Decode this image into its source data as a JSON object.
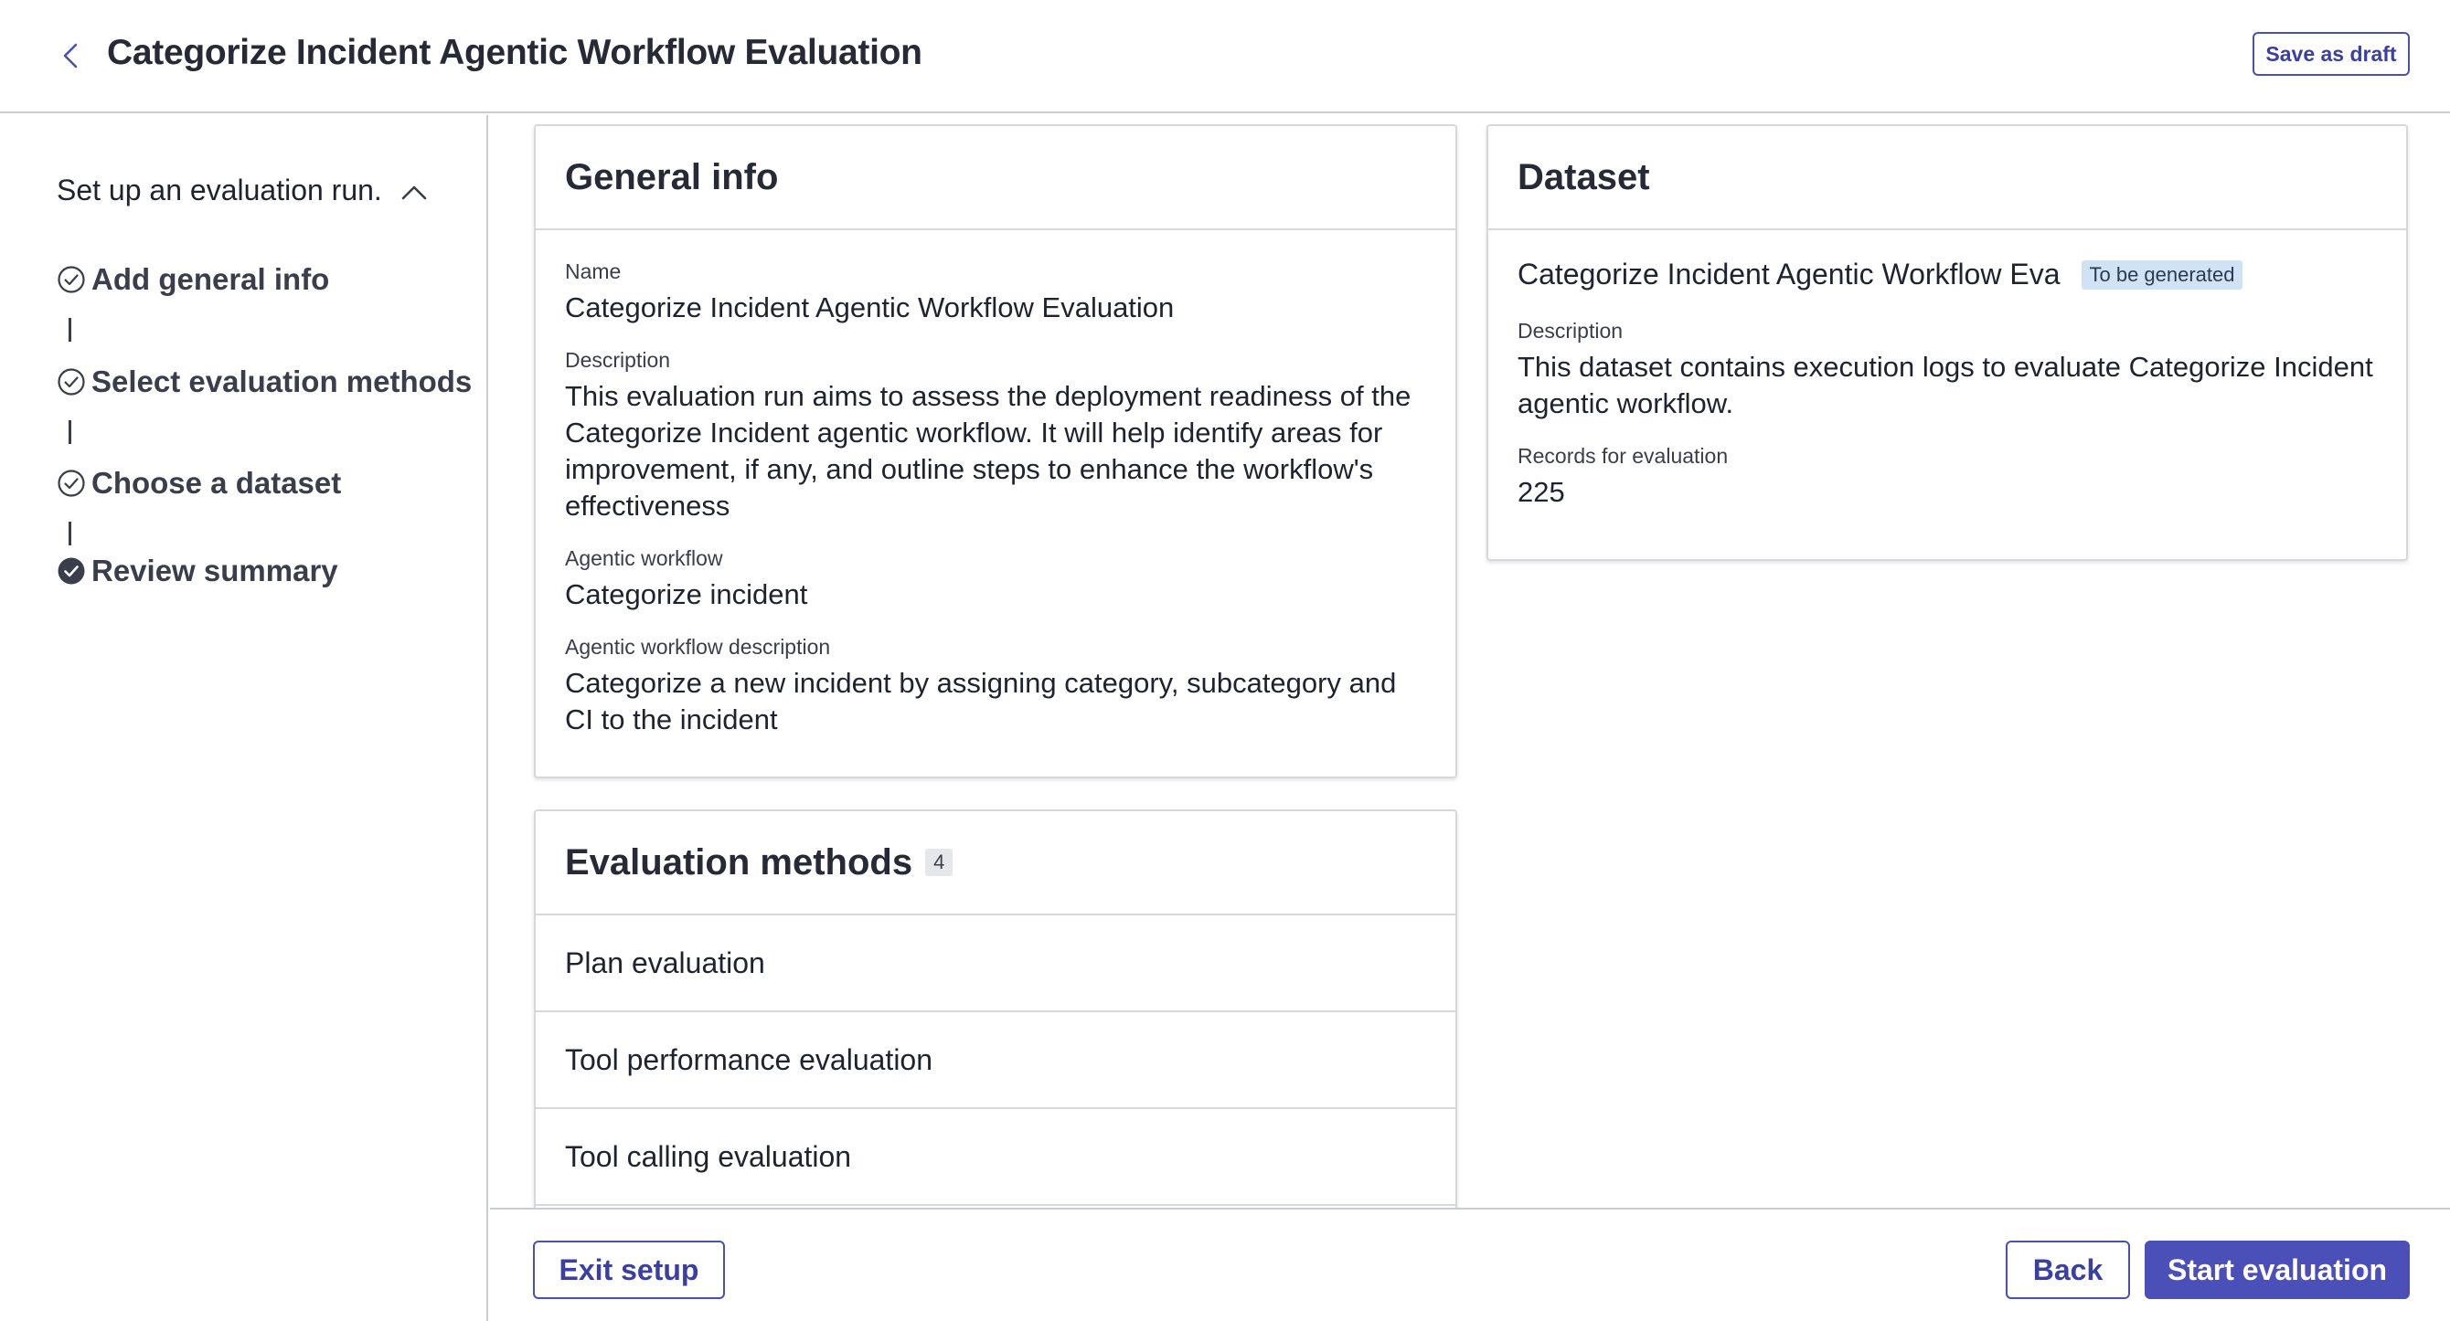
{
  "header": {
    "title": "Categorize Incident Agentic Workflow Evaluation",
    "save_draft_label": "Save as draft"
  },
  "sidebar": {
    "heading": "Set up an evaluation run.",
    "steps": [
      {
        "label": "Add general info",
        "status": "completed"
      },
      {
        "label": "Select evaluation methods",
        "status": "completed"
      },
      {
        "label": "Choose a dataset",
        "status": "completed"
      },
      {
        "label": "Review summary",
        "status": "current"
      }
    ]
  },
  "general_info": {
    "title": "General info",
    "name_label": "Name",
    "name_value": "Categorize Incident Agentic Workflow Evaluation",
    "description_label": "Description",
    "description_value": "This evaluation run aims to assess the deployment readiness of the Categorize Incident agentic workflow. It will help identify areas for improvement, if any, and outline steps to enhance the workflow's effectiveness",
    "workflow_label": "Agentic workflow",
    "workflow_value": "Categorize incident",
    "workflow_desc_label": "Agentic workflow description",
    "workflow_desc_value": "Categorize a new incident by assigning category, subcategory and CI to the incident"
  },
  "evaluation_methods": {
    "title": "Evaluation methods",
    "count": "4",
    "items": [
      "Plan evaluation",
      "Tool performance evaluation",
      "Tool calling evaluation"
    ]
  },
  "dataset": {
    "title": "Dataset",
    "name": "Categorize Incident Agentic Workflow Eva",
    "badge": "To be generated",
    "description_label": "Description",
    "description_value": "This dataset contains execution logs to evaluate Categorize Incident agentic workflow.",
    "records_label": "Records for evaluation",
    "records_value": "225"
  },
  "footer": {
    "exit_label": "Exit setup",
    "back_label": "Back",
    "start_label": "Start evaluation"
  },
  "colors": {
    "accent": "#4b4fb8",
    "badge_blue": "#cfe3f5",
    "border": "#d6d8de"
  }
}
